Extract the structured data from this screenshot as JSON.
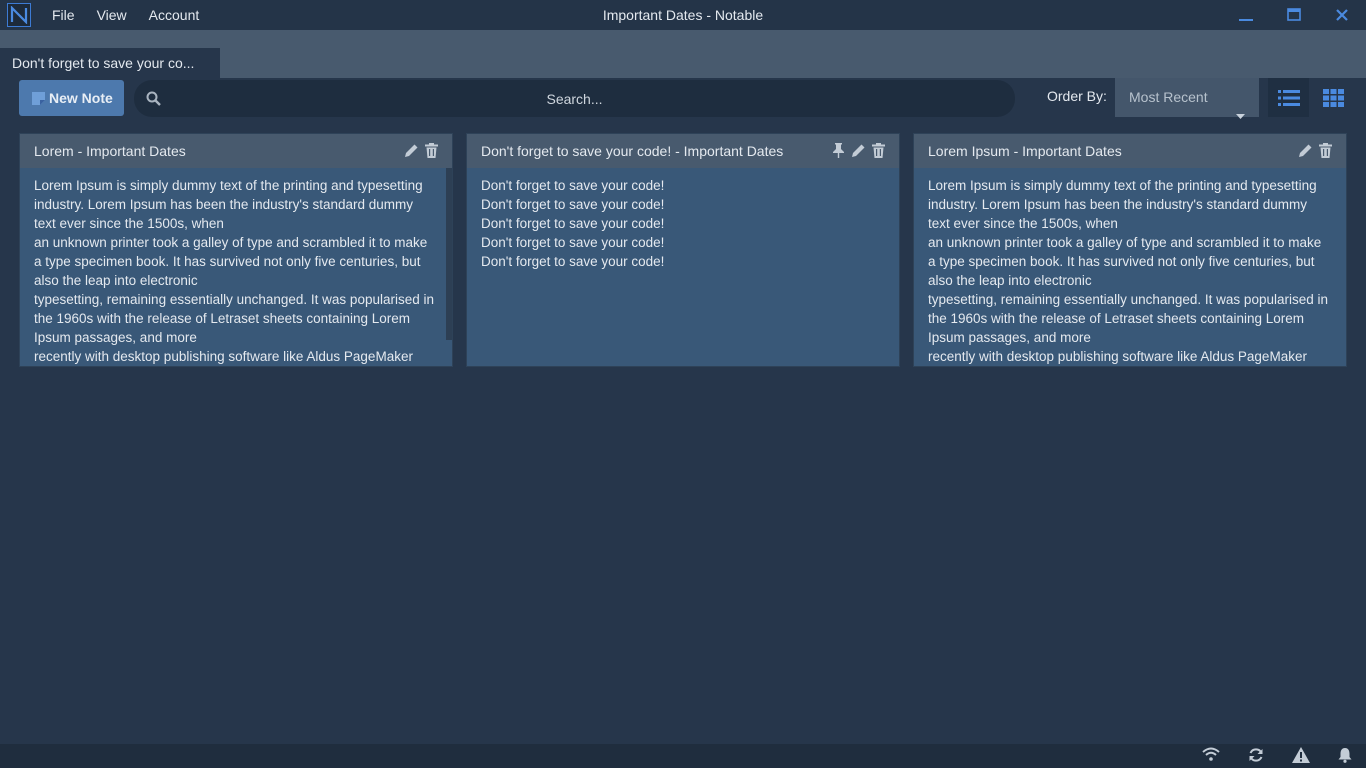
{
  "window": {
    "title": "Important Dates - Notable",
    "logo_letter": "N"
  },
  "menu": [
    {
      "label": "File"
    },
    {
      "label": "View"
    },
    {
      "label": "Account"
    }
  ],
  "tabs": [
    {
      "label": "Don't forget to save your co..."
    }
  ],
  "toolbar": {
    "new_note_label": "New Note",
    "search_placeholder": "Search...",
    "order_by_label": "Order By:",
    "order_by_value": "Most Recent"
  },
  "notes": [
    {
      "title": "Lorem  -  Important Dates",
      "body": "Lorem Ipsum is simply dummy text of the printing and typesetting industry. Lorem Ipsum has been the industry's standard dummy text ever since the 1500s, when\nan unknown printer took a galley of type and scrambled it to make a type specimen book. It has survived not only five centuries, but also the leap into electronic\ntypesetting, remaining essentially unchanged. It was popularised in the 1960s with the release of Letraset sheets containing Lorem Ipsum passages, and more\nrecently with desktop publishing software like Aldus PageMaker",
      "pinned": false
    },
    {
      "title": "Don't forget to save your code!  -  Important Dates",
      "body": "Don't forget to save your code!\nDon't forget to save your code!\nDon't forget to save your code!\nDon't forget to save your code!\nDon't forget to save your code!",
      "pinned": true
    },
    {
      "title": "Lorem Ipsum  -  Important Dates",
      "body": "Lorem Ipsum is simply dummy text of the printing and typesetting industry. Lorem Ipsum has been the industry's standard dummy text ever since the 1500s, when\nan unknown printer took a galley of type and scrambled it to make a type specimen book. It has survived not only five centuries, but also the leap into electronic\ntypesetting, remaining essentially unchanged. It was popularised in the 1960s with the release of Letraset sheets containing Lorem Ipsum passages, and more\nrecently with desktop publishing software like Aldus PageMaker",
      "pinned": false
    }
  ],
  "statusbar": {
    "icons": [
      "wifi-icon",
      "sync-icon",
      "warning-icon",
      "bell-icon"
    ]
  },
  "colors": {
    "background": "#26364b",
    "accent": "#4d79ad",
    "card_body": "#395878",
    "card_header": "#485a6e"
  }
}
